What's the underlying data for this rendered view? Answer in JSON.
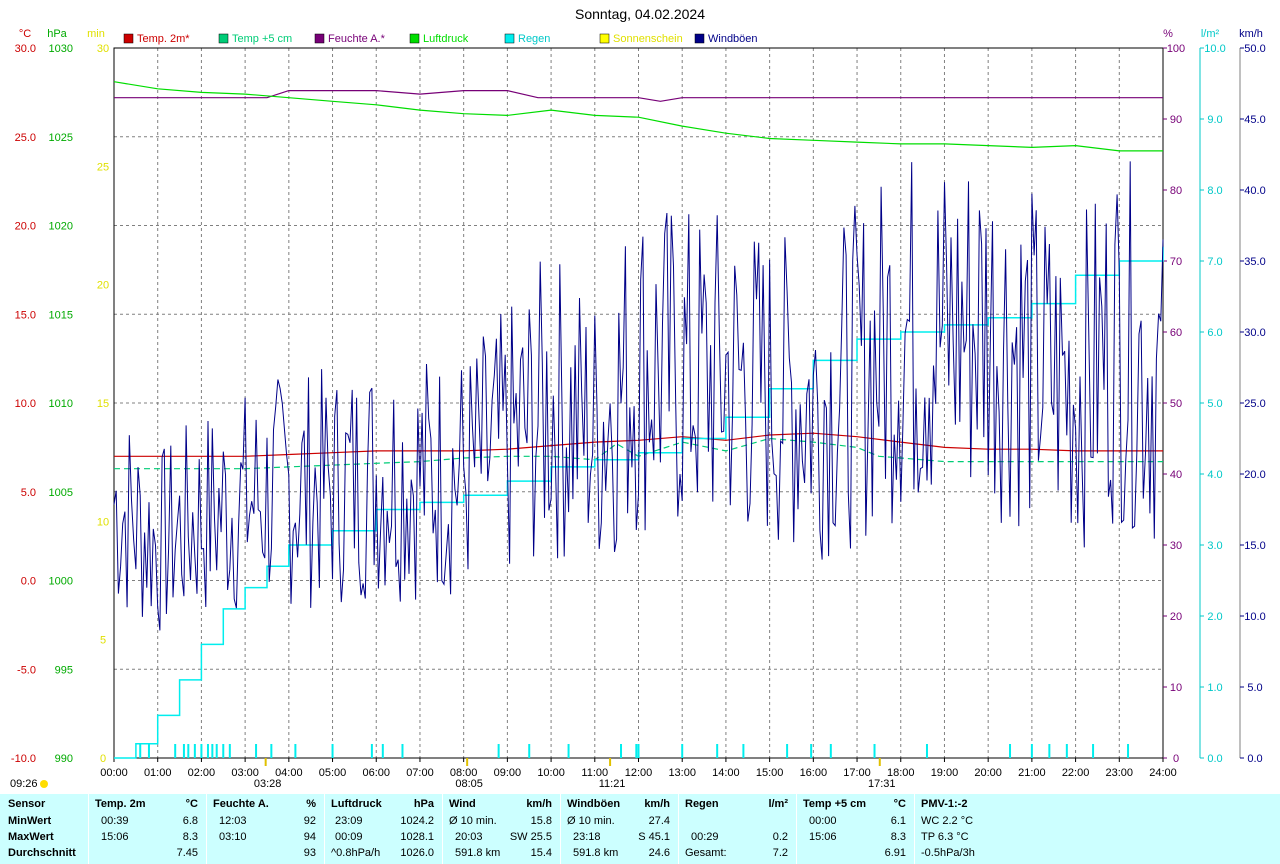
{
  "title": "Sonntag, 04.02.2024",
  "colors": {
    "temp2m": "#cc0000",
    "temp5cm": "#00cc77",
    "feuchte": "#770077",
    "luftdruck": "#00dd00",
    "regen": "#00eeee",
    "sonne": "#ffff00",
    "wind": "#000088",
    "grid": "#808080",
    "panel": "#ccffff"
  },
  "legend": [
    {
      "name": "Temp. 2m*",
      "color": "#cc0000"
    },
    {
      "name": "Temp +5 cm",
      "color": "#00cc77"
    },
    {
      "name": "Feuchte A.*",
      "color": "#770077"
    },
    {
      "name": "Luftdruck",
      "color": "#00dd00"
    },
    {
      "name": "Regen",
      "color": "#00eeee"
    },
    {
      "name": "Sonnenschein",
      "color": "#ffff00"
    },
    {
      "name": "Windböen",
      "color": "#000088"
    }
  ],
  "chart_data": {
    "type": "line",
    "title": "Sonntag, 04.02.2024",
    "x_ticks": [
      "00:00",
      "01:00",
      "02:00",
      "03:00",
      "04:00",
      "05:00",
      "06:00",
      "07:00",
      "08:00",
      "09:00",
      "10:00",
      "11:00",
      "12:00",
      "13:00",
      "14:00",
      "15:00",
      "16:00",
      "17:00",
      "18:00",
      "19:00",
      "20:00",
      "21:00",
      "22:00",
      "23:00",
      "24:00"
    ],
    "axes": {
      "temp": {
        "unit": "°C",
        "min": -10,
        "max": 30,
        "ticks": [
          "30.0",
          "25.0",
          "20.0",
          "15.0",
          "10.0",
          "5.0",
          "0.0",
          "-5.0",
          "-10.0"
        ]
      },
      "pressure": {
        "unit": "hPa",
        "min": 990,
        "max": 1030,
        "ticks": [
          "1030",
          "1025",
          "1020",
          "1015",
          "1010",
          "1005",
          "1000",
          "995",
          "990"
        ]
      },
      "sun": {
        "unit": "min",
        "min": 0,
        "max": 30,
        "ticks": [
          "30",
          "25",
          "20",
          "15",
          "10",
          "5",
          "0"
        ]
      },
      "humidity": {
        "unit": "%",
        "min": 0,
        "max": 100,
        "ticks": [
          "100",
          "90",
          "80",
          "70",
          "60",
          "50",
          "40",
          "30",
          "20",
          "10",
          "0"
        ]
      },
      "rain": {
        "unit": "l/m²",
        "min": 0,
        "max": 10,
        "ticks": [
          "10.0",
          "9.0",
          "8.0",
          "7.0",
          "6.0",
          "5.0",
          "4.0",
          "3.0",
          "2.0",
          "1.0",
          "0.0"
        ]
      },
      "wind": {
        "unit": "km/h",
        "min": 0,
        "max": 50,
        "ticks": [
          "50.0",
          "45.0",
          "40.0",
          "35.0",
          "30.0",
          "25.0",
          "20.0",
          "15.0",
          "10.0",
          "5.0",
          "0.0"
        ]
      }
    },
    "series": [
      {
        "name": "Temp. 2m*",
        "axis": "temp",
        "x": [
          0,
          1,
          2,
          3,
          4,
          5,
          6,
          7,
          8,
          9,
          10,
          11,
          12,
          13,
          14,
          15,
          16,
          17,
          18,
          19,
          20,
          21,
          22,
          23,
          24
        ],
        "y": [
          7.0,
          7.0,
          7.0,
          7.0,
          7.1,
          7.2,
          7.3,
          7.3,
          7.3,
          7.4,
          7.6,
          7.8,
          7.9,
          8.1,
          7.9,
          8.2,
          8.3,
          8.1,
          7.8,
          7.5,
          7.4,
          7.4,
          7.3,
          7.3,
          7.3
        ]
      },
      {
        "name": "Temp +5 cm",
        "axis": "temp",
        "x": [
          0,
          1,
          2,
          3,
          4,
          5,
          6,
          7,
          8,
          9,
          10,
          11,
          11.5,
          12,
          13,
          14,
          15,
          16,
          17,
          17.5,
          18,
          19,
          20,
          21,
          22,
          23,
          24
        ],
        "y": [
          6.3,
          6.3,
          6.3,
          6.3,
          6.4,
          6.5,
          6.6,
          6.7,
          6.9,
          7.0,
          7.0,
          6.8,
          7.7,
          7.0,
          7.8,
          7.3,
          8.0,
          7.8,
          7.5,
          7.0,
          6.9,
          6.7,
          6.7,
          6.7,
          6.7,
          6.7,
          6.7
        ]
      },
      {
        "name": "Feuchte A.*",
        "axis": "humidity",
        "x": [
          0,
          3,
          3.5,
          4,
          5,
          6,
          7,
          8,
          9,
          9.7,
          10,
          11,
          12,
          12.5,
          13,
          14,
          15,
          16,
          17,
          18,
          19,
          20,
          21,
          22,
          23,
          24
        ],
        "y": [
          93,
          93,
          93,
          94,
          94,
          94,
          93.5,
          94,
          94,
          93,
          93,
          93,
          93,
          92.5,
          93,
          93,
          93,
          93,
          93,
          93,
          93,
          93,
          93,
          93,
          93,
          93
        ]
      },
      {
        "name": "Luftdruck",
        "axis": "pressure",
        "x": [
          0,
          1,
          2,
          3,
          4,
          5,
          6,
          7,
          8,
          9,
          10,
          11,
          12,
          13,
          14,
          15,
          16,
          17,
          18,
          19,
          20,
          21,
          22,
          23,
          24
        ],
        "y": [
          1028.1,
          1027.7,
          1027.5,
          1027.4,
          1027.2,
          1027.0,
          1026.8,
          1026.5,
          1026.3,
          1026.2,
          1026.5,
          1026.2,
          1026.1,
          1025.6,
          1025.2,
          1024.9,
          1024.8,
          1024.7,
          1024.6,
          1024.6,
          1024.5,
          1024.4,
          1024.5,
          1024.2,
          1024.2
        ]
      },
      {
        "name": "Regen",
        "axis": "rain",
        "x": [
          0,
          0.5,
          1,
          1.5,
          2,
          2.5,
          3,
          3.5,
          4,
          5,
          6,
          7,
          8,
          9,
          10,
          11,
          12,
          13,
          14,
          15,
          16,
          17,
          18,
          19,
          20,
          21,
          22,
          23,
          24
        ],
        "y": [
          0.0,
          0.2,
          0.6,
          1.1,
          1.6,
          2.1,
          2.4,
          2.7,
          3.0,
          3.2,
          3.5,
          3.6,
          3.7,
          3.9,
          4.1,
          4.2,
          4.3,
          4.5,
          4.8,
          5.2,
          5.6,
          5.9,
          6.0,
          6.1,
          6.2,
          6.4,
          6.8,
          7.0,
          7.2
        ]
      },
      {
        "name": "Windböen",
        "axis": "wind",
        "x": [
          0,
          1,
          2,
          3,
          4,
          5,
          6,
          7,
          8,
          9,
          10,
          11,
          12,
          13,
          14,
          15,
          16,
          17,
          18,
          19,
          20,
          21,
          22,
          23,
          24
        ],
        "y": [
          18,
          15,
          17,
          18,
          19,
          19,
          20,
          20,
          20,
          22,
          25,
          23,
          28,
          27,
          27,
          26,
          25,
          27,
          30,
          30,
          31,
          28,
          26,
          30,
          26
        ]
      }
    ],
    "rain_events": [
      0.6,
      0.8,
      1.4,
      1.6,
      1.7,
      1.85,
      2.0,
      2.15,
      2.25,
      2.35,
      2.5,
      2.65,
      3.25,
      3.6,
      4.15,
      5.0,
      5.9,
      6.15,
      6.6,
      8.8,
      9.5,
      10.4,
      11.6,
      11.95,
      12.0,
      13.0,
      13.8,
      14.4,
      15.4,
      15.95,
      16.4,
      17.4,
      18.6,
      20.5,
      21.0,
      21.4,
      21.8,
      22.4,
      23.2
    ],
    "sun_events": [
      {
        "label": "03:28",
        "x": 3.47
      },
      {
        "label": "08:05",
        "x": 8.08
      },
      {
        "label": "11:21",
        "x": 11.35
      },
      {
        "label": "17:31",
        "x": 17.52
      }
    ],
    "day_start_label": "09:26"
  },
  "table": {
    "row_labels": [
      "Sensor",
      "MinWert",
      "MaxWert",
      "Durchschnitt"
    ],
    "temp2m": {
      "header": "Temp. 2m",
      "unit": "°C",
      "min_time": "00:39",
      "min_val": "6.8",
      "max_time": "15:06",
      "max_val": "8.3",
      "avg": "7.45"
    },
    "feuchte": {
      "header": "Feuchte A.",
      "unit": "%",
      "min_time": "12:03",
      "min_val": "92",
      "max_time": "03:10",
      "max_val": "94",
      "avg": "93"
    },
    "luftdruck": {
      "header": "Luftdruck",
      "unit": "hPa",
      "min_time": "23:09",
      "min_val": "1024.2",
      "max_time": "00:09",
      "max_val": "1028.1",
      "trend": "^0.8hPa/h",
      "avg": "1026.0"
    },
    "wind": {
      "header": "Wind",
      "unit": "km/h",
      "r1_label": "Ø 10 min.",
      "r1_val": "15.8",
      "r2_time": "20:03",
      "r2_dir": "SW 25.5",
      "r3_dist": "591.8 km",
      "r3_val": "15.4"
    },
    "windboeen": {
      "header": "Windböen",
      "unit": "km/h",
      "r1_label": "Ø 10 min.",
      "r1_val": "27.4",
      "r2_time": "23:18",
      "r2_dir": "S 45.1",
      "r3_dist": "591.8 km",
      "r3_val": "24.6"
    },
    "regen": {
      "header": "Regen",
      "unit": "l/m²",
      "r2_time": "00:29",
      "r2_val": "0.2",
      "r3_label": "Gesamt:",
      "r3_val": "7.2"
    },
    "temp5cm": {
      "header": "Temp +5 cm",
      "unit": "°C",
      "min_time": "00:00",
      "min_val": "6.1",
      "max_time": "15:06",
      "max_val": "8.3",
      "avg": "6.91"
    },
    "pmv": {
      "header": "PMV-1:-2",
      "wc": "WC 2.2 °C",
      "tp": "TP 6.3 °C",
      "trend": "-0.5hPa/3h"
    }
  }
}
